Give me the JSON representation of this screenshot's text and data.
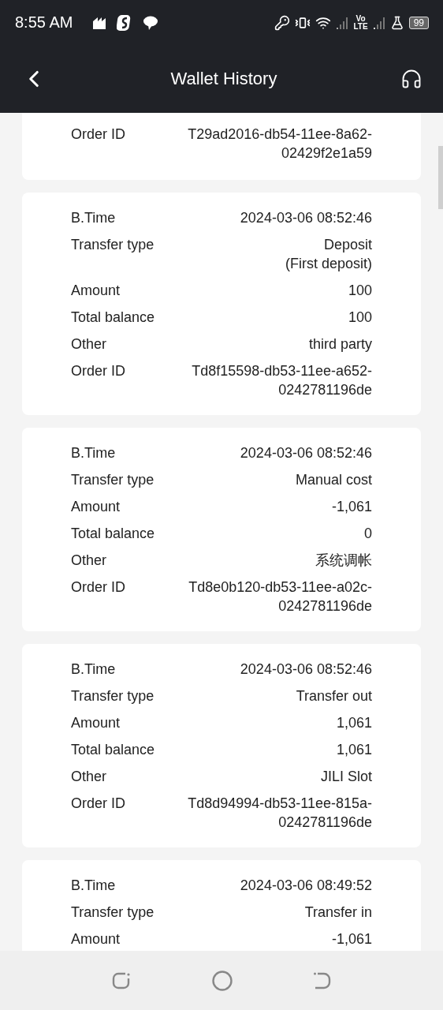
{
  "status_bar": {
    "time": "8:55 AM",
    "network_label": [
      "Vo",
      "LTE"
    ],
    "battery": "99"
  },
  "header": {
    "title": "Wallet History"
  },
  "records": [
    {
      "rows": [
        {
          "label": "Order ID",
          "value": "T29ad2016-db54-11ee-8a62-\n02429f2e1a59"
        }
      ]
    },
    {
      "rows": [
        {
          "label": "B.Time",
          "value": "2024-03-06 08:52:46"
        },
        {
          "label": "Transfer type",
          "value": "Deposit\n(First deposit)"
        },
        {
          "label": "Amount",
          "value": "100"
        },
        {
          "label": "Total balance",
          "value": "100"
        },
        {
          "label": "Other",
          "value": "third party"
        },
        {
          "label": "Order ID",
          "value": "Td8f15598-db53-11ee-a652-\n0242781196de"
        }
      ]
    },
    {
      "rows": [
        {
          "label": "B.Time",
          "value": "2024-03-06 08:52:46"
        },
        {
          "label": "Transfer type",
          "value": "Manual cost"
        },
        {
          "label": "Amount",
          "value": "-1,061"
        },
        {
          "label": "Total balance",
          "value": "0"
        },
        {
          "label": "Other",
          "value": "系统调帐"
        },
        {
          "label": "Order ID",
          "value": "Td8e0b120-db53-11ee-a02c-\n0242781196de"
        }
      ]
    },
    {
      "rows": [
        {
          "label": "B.Time",
          "value": "2024-03-06 08:52:46"
        },
        {
          "label": "Transfer type",
          "value": "Transfer out"
        },
        {
          "label": "Amount",
          "value": "1,061"
        },
        {
          "label": "Total balance",
          "value": "1,061"
        },
        {
          "label": "Other",
          "value": "JILI Slot"
        },
        {
          "label": "Order ID",
          "value": "Td8d94994-db53-11ee-815a-\n0242781196de"
        }
      ]
    },
    {
      "rows": [
        {
          "label": "B.Time",
          "value": "2024-03-06 08:49:52"
        },
        {
          "label": "Transfer type",
          "value": "Transfer in"
        },
        {
          "label": "Amount",
          "value": "-1,061"
        }
      ]
    }
  ]
}
